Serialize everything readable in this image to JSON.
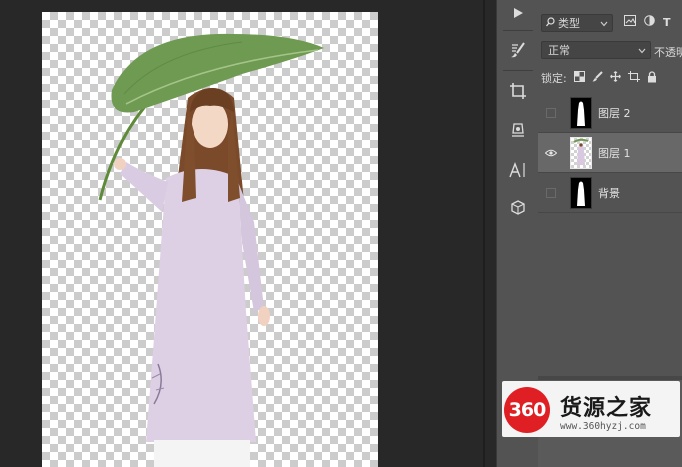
{
  "colors": {
    "app_background": "#282828",
    "panel_background": "#535353",
    "selected_layer": "#686868",
    "brand_red": "#e01f25"
  },
  "tools": [
    {
      "name": "play-icon"
    },
    {
      "name": "brush-settings-icon"
    },
    {
      "name": "crop-icon"
    },
    {
      "name": "3d-object-icon"
    },
    {
      "name": "type-icon",
      "label": "A|"
    },
    {
      "name": "3d-cube-icon"
    }
  ],
  "layers_panel": {
    "kind_filter": "类型",
    "filter_icon_text": "T",
    "blend_mode": "正常",
    "opacity_label": "不透明",
    "lock_label": "锁定:",
    "layers": [
      {
        "name": "图层 2",
        "visible": false,
        "selected": false,
        "thumbnail": "black-silhouette"
      },
      {
        "name": "图层 1",
        "visible": true,
        "selected": true,
        "thumbnail": "transparent-figure"
      },
      {
        "name": "背景",
        "visible": false,
        "selected": false,
        "thumbnail": "black-silhouette"
      }
    ]
  },
  "watermark": {
    "logo_text": "360",
    "name": "货源之家",
    "url": "www.360hyzj.com"
  }
}
